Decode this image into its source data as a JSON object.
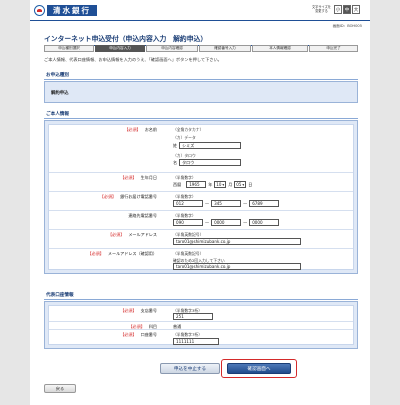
{
  "header": {
    "bank_name": "清水銀行",
    "font_size_label_1": "文字サイズを",
    "font_size_label_2": "変更する",
    "font_sizes": [
      "小",
      "中",
      "大"
    ],
    "screen_id": "画面ID：BOH005"
  },
  "page_title": "インターネット申込受付（申込内容入力　解約申込）",
  "steps": [
    "申込種別選択",
    "申込内容入力",
    "申込内容確認",
    "確認番号入力",
    "本人情報確認",
    "申込完了"
  ],
  "active_step": 1,
  "intro": "ご本人情報、代表口座情報、お申込情報を入力のうえ、「確認画面へ」ボタンを押して下さい。",
  "application_type": {
    "title": "お申込種別",
    "value": "解約申込"
  },
  "personal_info": {
    "title": "ご本人情報",
    "required_tag": "【必須】",
    "name": {
      "label": "お名前",
      "hint": "（全角カタカナ）",
      "kana_hint": "（カ）データ",
      "sei_label": "姓",
      "sei_value": "シミズ",
      "mei_kana_hint": "（カ）タロウ",
      "mei_label": "名",
      "mei_value": "タロウ"
    },
    "birthday": {
      "label": "生年月日",
      "hint": "（半角数字）",
      "era": "西暦",
      "year": "1965",
      "year_unit": "年",
      "month": "10",
      "month_unit": "月",
      "day": "05",
      "day_unit": "日"
    },
    "registered_phone": {
      "label": "銀行お届け電話番号",
      "hint": "（半角数字）",
      "p1": "012",
      "p2": "345",
      "p3": "6789"
    },
    "contact_phone": {
      "label": "連絡先電話番号",
      "hint": "（半角数字）",
      "p1": "090",
      "p2": "0000",
      "p3": "0000"
    },
    "email": {
      "label": "メールアドレス",
      "hint": "（半角英数記号）",
      "value": "taro01@shimizubank.co.jp"
    },
    "email_confirm": {
      "label": "メールアドレス（確認用）",
      "hint": "（半角英数記号）",
      "hint2": "確認のため2回入力して下さい",
      "value": "taro01@shimizubank.co.jp"
    }
  },
  "account_info": {
    "title": "代表口座情報",
    "branch": {
      "label": "支店番号",
      "hint": "（半角数字3桁）",
      "value": "251"
    },
    "subject": {
      "label": "科目",
      "value": "普通"
    },
    "account": {
      "label": "口座番号",
      "hint": "（半角数字7桁）",
      "value": "1111111"
    }
  },
  "buttons": {
    "cancel": "申込を中止する",
    "confirm": "確認画面へ",
    "back": "戻る"
  },
  "accent_colors": {
    "brand": "#1f4f96",
    "required": "#d42a2a",
    "panel": "#dfe8f6"
  }
}
